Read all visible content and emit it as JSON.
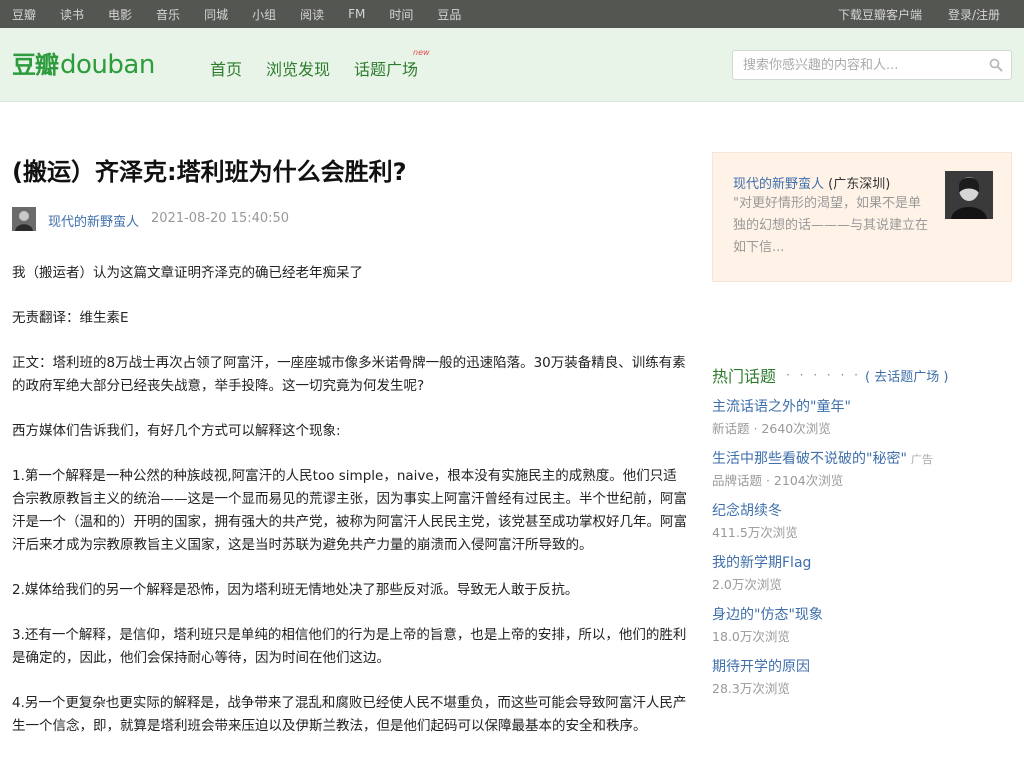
{
  "topbar": {
    "left_items": [
      "豆瓣",
      "读书",
      "电影",
      "音乐",
      "同城",
      "小组",
      "阅读",
      "FM",
      "时间",
      "豆品"
    ],
    "download": "下载豆瓣客户端",
    "login": "登录/注册"
  },
  "header": {
    "logo_cn": "豆瓣",
    "logo_en": "douban",
    "nav": [
      "首页",
      "浏览发现",
      "话题广场"
    ],
    "new_badge": "new",
    "search_placeholder": "搜索你感兴趣的内容和人..."
  },
  "article": {
    "title": "(搬运）齐泽克:塔利班为什么会胜利?",
    "author": "现代的新野蛮人",
    "time": "2021-08-20 15:40:50",
    "paragraphs": [
      "我（搬运者）认为这篇文章证明齐泽克的确已经老年痴呆了",
      "无责翻译：维生素E",
      "正文：塔利班的8万战士再次占领了阿富汗，一座座城市像多米诺骨牌一般的迅速陷落。30万装备精良、训练有素的政府军绝大部分已经丧失战意，举手投降。这一切究竟为何发生呢?",
      "西方媒体们告诉我们，有好几个方式可以解释这个现象:",
      "1.第一个解释是一种公然的种族歧视,阿富汗的人民too simple，naive，根本没有实施民主的成熟度。他们只适合宗教原教旨主义的统治——这是一个显而易见的荒谬主张，因为事实上阿富汗曾经有过民主。半个世纪前，阿富汗是一个（温和的）开明的国家，拥有强大的共产党，被称为阿富汗人民民主党，该党甚至成功掌权好几年。阿富汗后来才成为宗教原教旨主义国家，这是当时苏联为避免共产力量的崩溃而入侵阿富汗所导致的。",
      "2.媒体给我们的另一个解释是恐怖，因为塔利班无情地处决了那些反对派。导致无人敢于反抗。",
      "3.还有一个解释，是信仰，塔利班只是单纯的相信他们的行为是上帝的旨意，也是上帝的安排，所以，他们的胜利是确定的，因此，他们会保持耐心等待，因为时间在他们这边。",
      "4.另一个更复杂也更实际的解释是，战争带来了混乱和腐败已经使人民不堪重负，而这些可能会导致阿富汗人民产生一个信念，即，就算是塔利班会带来压迫以及伊斯兰教法，但是他们起码可以保障最基本的安全和秩序。"
    ]
  },
  "profile": {
    "name": "现代的新野蛮人",
    "location": "(广东深圳)",
    "quote": "\"对更好情形的渴望，如果不是单独的幻想的话———与其说建立在如下信..."
  },
  "hot": {
    "title": "热门话题",
    "dots": "· · · · · ·",
    "link": "( 去话题广场 )",
    "topics": [
      {
        "title": "主流话语之外的\"童年\"",
        "meta": "新话题 · 2640次浏览",
        "ad": ""
      },
      {
        "title": "生活中那些看破不说破的\"秘密\"",
        "meta": "品牌话题 · 2104次浏览",
        "ad": "广告"
      },
      {
        "title": "纪念胡续冬",
        "meta": "411.5万次浏览",
        "ad": ""
      },
      {
        "title": "我的新学期Flag",
        "meta": "2.0万次浏览",
        "ad": ""
      },
      {
        "title": "身边的\"仿态\"现象",
        "meta": "18.0万次浏览",
        "ad": ""
      },
      {
        "title": "期待开学的原因",
        "meta": "28.3万次浏览",
        "ad": ""
      }
    ]
  },
  "colors": {
    "topbar_bg": "#545652",
    "header_bg": "#e9f4e9",
    "brand_green": "#2d9c3c",
    "link_blue": "#3f6fab",
    "profile_bg": "#fff3e8"
  }
}
